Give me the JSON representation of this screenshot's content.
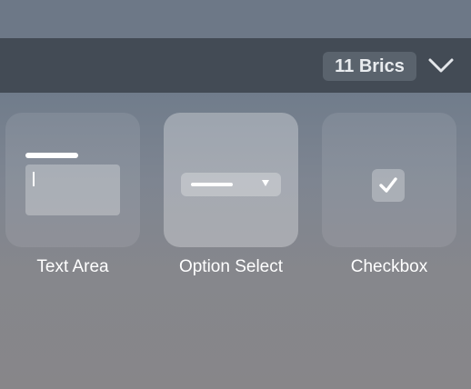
{
  "header": {
    "brick_count_label": "11 Brics",
    "expand_icon": "chevron-down-icon"
  },
  "bricks": [
    {
      "label": "Text Area",
      "icon": "text-area-icon",
      "selected": false
    },
    {
      "label": "Option Select",
      "icon": "option-select-icon",
      "selected": true
    },
    {
      "label": "Checkbox",
      "icon": "checkbox-icon",
      "selected": false
    }
  ]
}
